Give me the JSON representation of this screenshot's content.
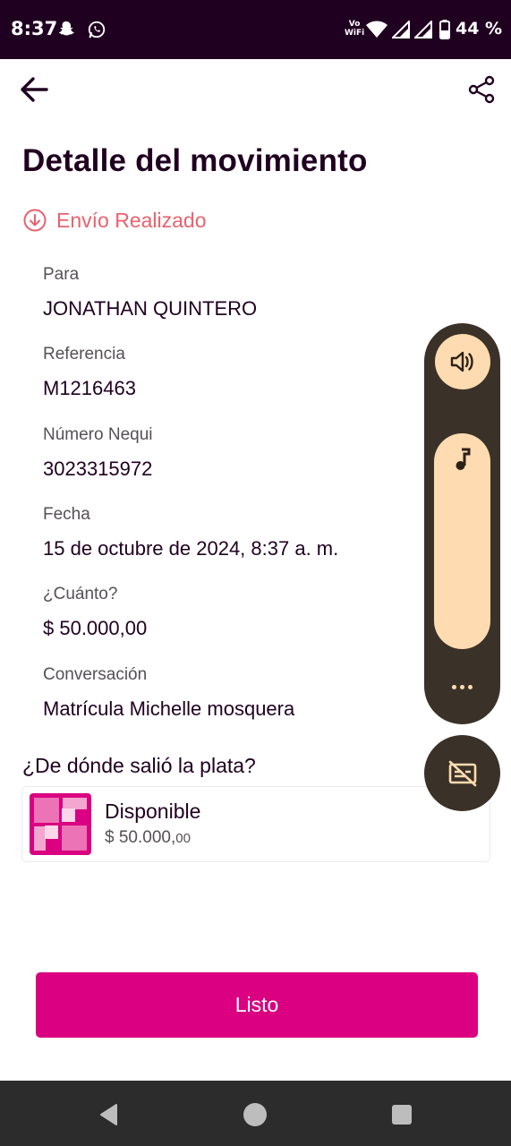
{
  "status_bar": {
    "time": "8:37",
    "vowifi_top": "Vo",
    "vowifi_bottom": "WiFi",
    "battery": "44 %",
    "icons": [
      "snapchat-icon",
      "whatsapp-icon",
      "wifi-icon",
      "signal-icon",
      "signal-icon",
      "battery-icon"
    ]
  },
  "header": {
    "back_icon": "arrow-left-icon",
    "share_icon": "share-icon",
    "title": "Detalle del movimiento"
  },
  "transaction": {
    "status_icon": "arrow-down-circle-icon",
    "status_text": "Envío Realizado",
    "status_color": "#e8626e",
    "fields": [
      {
        "label": "Para",
        "value": "JONATHAN QUINTERO"
      },
      {
        "label": "Referencia",
        "value": "M1216463"
      },
      {
        "label": "Número Nequi",
        "value": "3023315972"
      },
      {
        "label": "Fecha",
        "value": "15 de octubre de 2024, 8:37 a. m."
      },
      {
        "label": "¿Cuánto?",
        "value": "$ 50.000,00"
      },
      {
        "label": "Conversación",
        "value": "Matrícula Michelle mosquera"
      }
    ]
  },
  "source": {
    "title": "¿De dónde salió la plata?",
    "account_name": "Disponible",
    "amount_main": "$ 50.000,",
    "amount_cents": "00",
    "logo_color": "#da0081"
  },
  "actions": {
    "done_label": "Listo",
    "brand_color": "#da0081"
  },
  "volume_overlay": {
    "speaker_icon": "speaker-icon",
    "music_icon": "music-note-icon",
    "more_icon": "more-dots-icon",
    "captions_icon": "captions-off-icon",
    "level": 1.0
  },
  "nav_bar": {
    "back": "nav-back-icon",
    "home": "nav-home-icon",
    "recents": "nav-recents-icon"
  }
}
